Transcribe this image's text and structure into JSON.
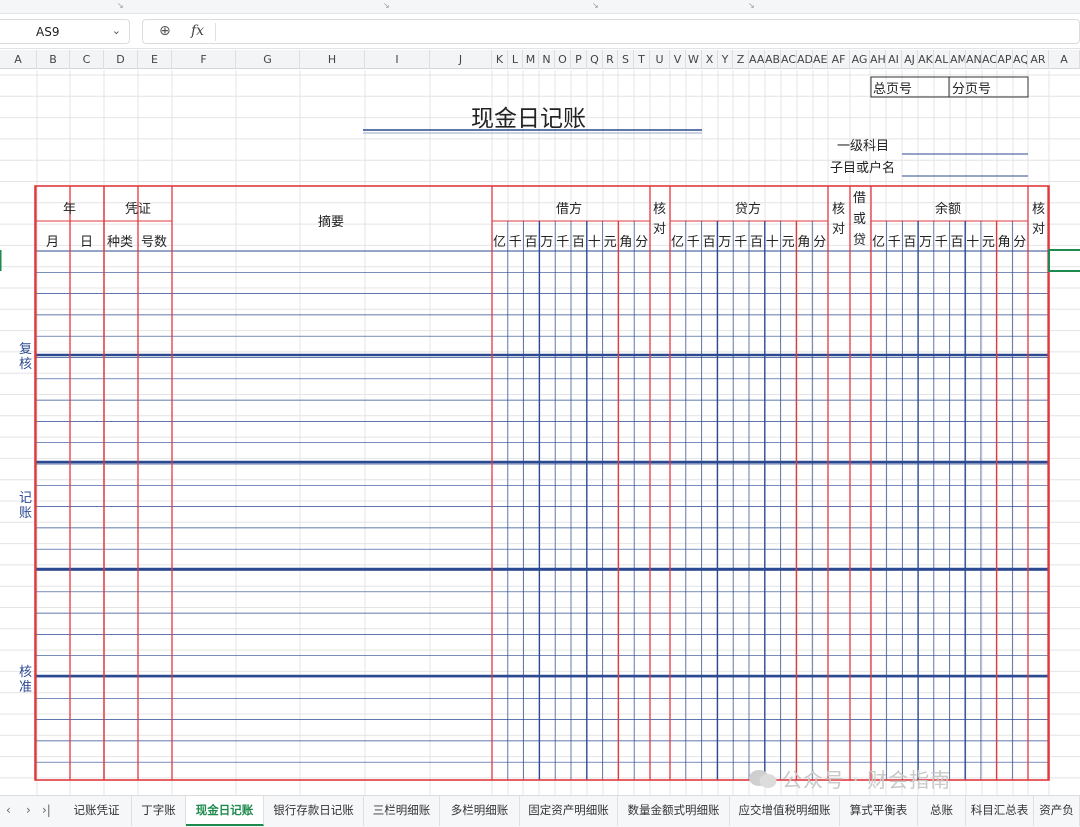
{
  "name_box": {
    "value": "AS9"
  },
  "formula_bar": {
    "fx_label": "fx",
    "value": ""
  },
  "columns": [
    "A",
    "B",
    "C",
    "D",
    "E",
    "F",
    "G",
    "H",
    "I",
    "J",
    "K",
    "L",
    "M",
    "N",
    "O",
    "P",
    "Q",
    "R",
    "S",
    "T",
    "U",
    "V",
    "W",
    "X",
    "Y",
    "Z",
    "AA",
    "AB",
    "AC",
    "AD",
    "AE",
    "AF",
    "AG",
    "AH",
    "AI",
    "AJ",
    "AK",
    "AL",
    "AM",
    "AN",
    "AC",
    "AP",
    "AQ",
    "AR",
    "A"
  ],
  "sheet": {
    "title": "现金日记账",
    "total_page_label": "总页号",
    "sub_page_label": "分页号",
    "level1_subject_label": "一级科目",
    "sub_account_label": "子目或户名",
    "headers": {
      "year": "年",
      "voucher": "凭证",
      "month": "月",
      "day": "日",
      "kind": "种类",
      "number": "号数",
      "summary": "摘要",
      "debit": "借方",
      "credit": "贷方",
      "check1": "核对",
      "dir": "借或贷",
      "balance": "余额",
      "check2": "核对"
    },
    "digit_units": [
      "亿",
      "千",
      "百",
      "万",
      "千",
      "百",
      "十",
      "元",
      "角",
      "分"
    ],
    "side_labels": {
      "review": "复核",
      "bookkeeping": "记账",
      "approval": "核准"
    }
  },
  "sheet_tabs": [
    "记账凭证",
    "丁字账",
    "现金日记账",
    "银行存款日记账",
    "三栏明细账",
    "多栏明细账",
    "固定资产明细账",
    "数量金额式明细账",
    "应交增值税明细账",
    "算式平衡表",
    "总账",
    "科目汇总表",
    "资产负"
  ],
  "active_tab": "现金日记账",
  "tab_nav": [
    "‹",
    "›",
    "›|"
  ],
  "watermark": "公众号 · 财会指南",
  "colors": {
    "red_border": "#e0393e",
    "blue_line": "#2c4a92",
    "grid": "#e4e4e4",
    "accent": "#1e8a4e"
  }
}
